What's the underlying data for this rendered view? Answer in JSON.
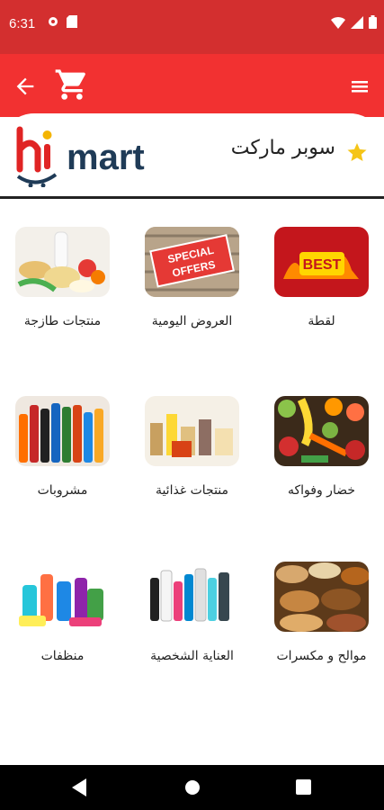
{
  "status": {
    "time": "6:31"
  },
  "header": {
    "store_title": "سوبر ماركت"
  },
  "categories": [
    {
      "label": "لقطة",
      "icon": "best-offer-image"
    },
    {
      "label": "العروض اليومية",
      "icon": "special-offers-image"
    },
    {
      "label": "منتجات طازجة",
      "icon": "fresh-products-image"
    },
    {
      "label": "خضار وفواكه",
      "icon": "vegetables-fruits-image"
    },
    {
      "label": "منتجات غذائية",
      "icon": "food-products-image"
    },
    {
      "label": "مشروبات",
      "icon": "drinks-image"
    },
    {
      "label": "موالح و مكسرات",
      "icon": "nuts-image"
    },
    {
      "label": "العناية الشخصية",
      "icon": "personal-care-image"
    },
    {
      "label": "منظفات",
      "icon": "cleaners-image"
    }
  ],
  "logo": {
    "text_hi": "hi",
    "text_mart": "mart"
  },
  "colors": {
    "status_bar": "#d32f2f",
    "app_bar": "#f23131",
    "accent_star": "#f5c518"
  }
}
